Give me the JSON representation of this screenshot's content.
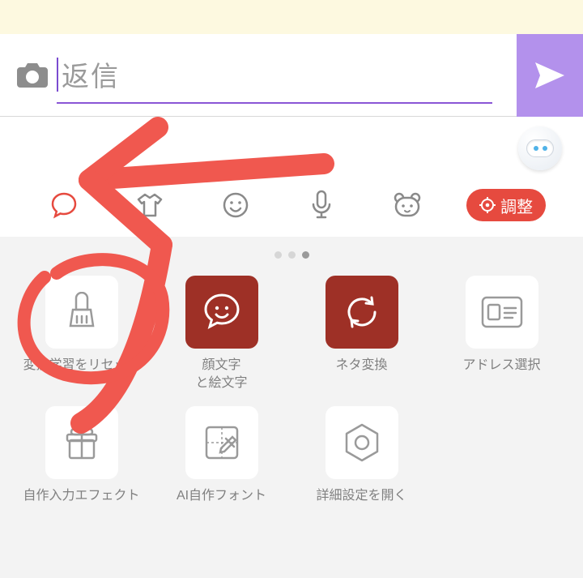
{
  "input": {
    "placeholder": "返信"
  },
  "adjust_button": {
    "label": "調整"
  },
  "toolbar_icons": [
    "speech-bubble-icon",
    "shirt-icon",
    "smiley-icon",
    "microphone-icon",
    "bear-icon"
  ],
  "page_dots": {
    "count": 3,
    "active_index": 2
  },
  "grid": [
    {
      "id": "reset-learning",
      "label": "変換学習をリセット",
      "icon": "broom-icon",
      "variant": "white"
    },
    {
      "id": "kaomoji-emoji",
      "label": "顔文字\nと絵文字",
      "icon": "face-bubble-icon",
      "variant": "brand"
    },
    {
      "id": "neta-convert",
      "label": "ネタ変換",
      "icon": "cycle-icon",
      "variant": "brand"
    },
    {
      "id": "address-select",
      "label": "アドレス選択",
      "icon": "address-card-icon",
      "variant": "white"
    },
    {
      "id": "custom-effect",
      "label": "自作入力エフェクト",
      "icon": "gift-icon",
      "variant": "white"
    },
    {
      "id": "ai-font",
      "label": "AI自作フォント",
      "icon": "font-edit-icon",
      "variant": "white"
    },
    {
      "id": "open-settings",
      "label": "詳細設定を開く",
      "icon": "hex-gear-icon",
      "variant": "white"
    }
  ],
  "annotation": {
    "stroke": "#f0584f"
  }
}
